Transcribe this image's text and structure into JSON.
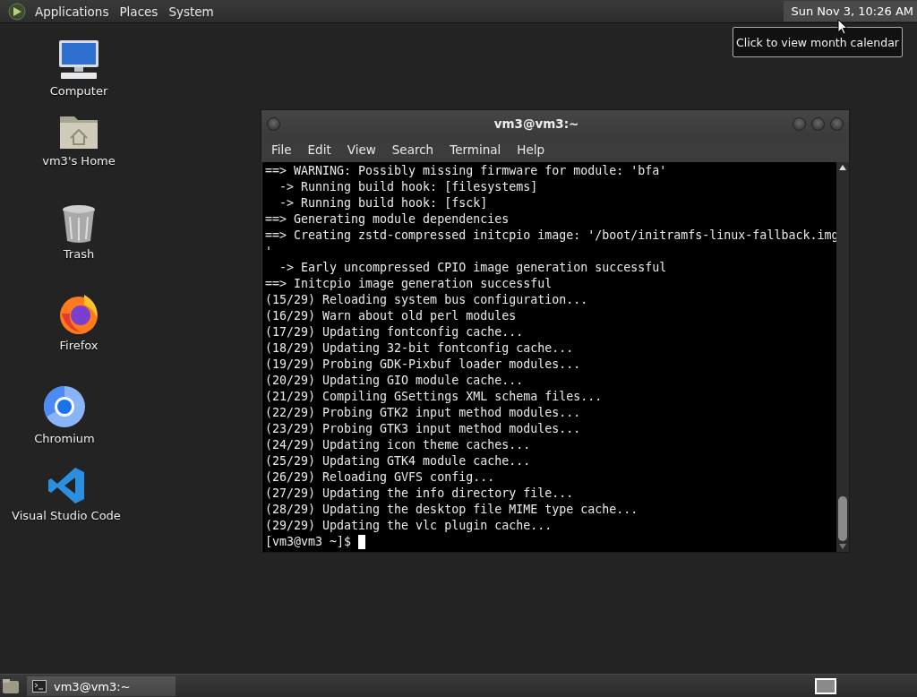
{
  "top_panel": {
    "menus": [
      "Applications",
      "Places",
      "System"
    ],
    "clock": "Sun Nov  3, 10:26 AM"
  },
  "tooltip": "Click to view month calendar",
  "desktop_icons": [
    {
      "kind": "computer",
      "label": "Computer"
    },
    {
      "kind": "home",
      "label": "vm3's Home"
    },
    {
      "kind": "trash",
      "label": "Trash"
    },
    {
      "kind": "firefox",
      "label": "Firefox"
    },
    {
      "kind": "chromium",
      "label": "Chromium"
    },
    {
      "kind": "vscode",
      "label": "Visual Studio Code"
    }
  ],
  "terminal": {
    "title": "vm3@vm3:~",
    "menu": [
      "File",
      "Edit",
      "View",
      "Search",
      "Terminal",
      "Help"
    ],
    "lines": [
      "==> WARNING: Possibly missing firmware for module: 'bfa'",
      "  -> Running build hook: [filesystems]",
      "  -> Running build hook: [fsck]",
      "==> Generating module dependencies",
      "==> Creating zstd-compressed initcpio image: '/boot/initramfs-linux-fallback.img",
      "'",
      "  -> Early uncompressed CPIO image generation successful",
      "==> Initcpio image generation successful",
      "(15/29) Reloading system bus configuration...",
      "(16/29) Warn about old perl modules",
      "(17/29) Updating fontconfig cache...",
      "(18/29) Updating 32-bit fontconfig cache...",
      "(19/29) Probing GDK-Pixbuf loader modules...",
      "(20/29) Updating GIO module cache...",
      "(21/29) Compiling GSettings XML schema files...",
      "(22/29) Probing GTK2 input method modules...",
      "(23/29) Probing GTK3 input method modules...",
      "(24/29) Updating icon theme caches...",
      "(25/29) Updating GTK4 module cache...",
      "(26/29) Reloading GVFS config...",
      "(27/29) Updating the info directory file...",
      "(28/29) Updating the desktop file MIME type cache...",
      "(29/29) Updating the vlc plugin cache..."
    ],
    "prompt": "[vm3@vm3 ~]$"
  },
  "taskbar": {
    "tasks": [
      {
        "label": "vm3@vm3:~",
        "selected": true
      }
    ]
  }
}
